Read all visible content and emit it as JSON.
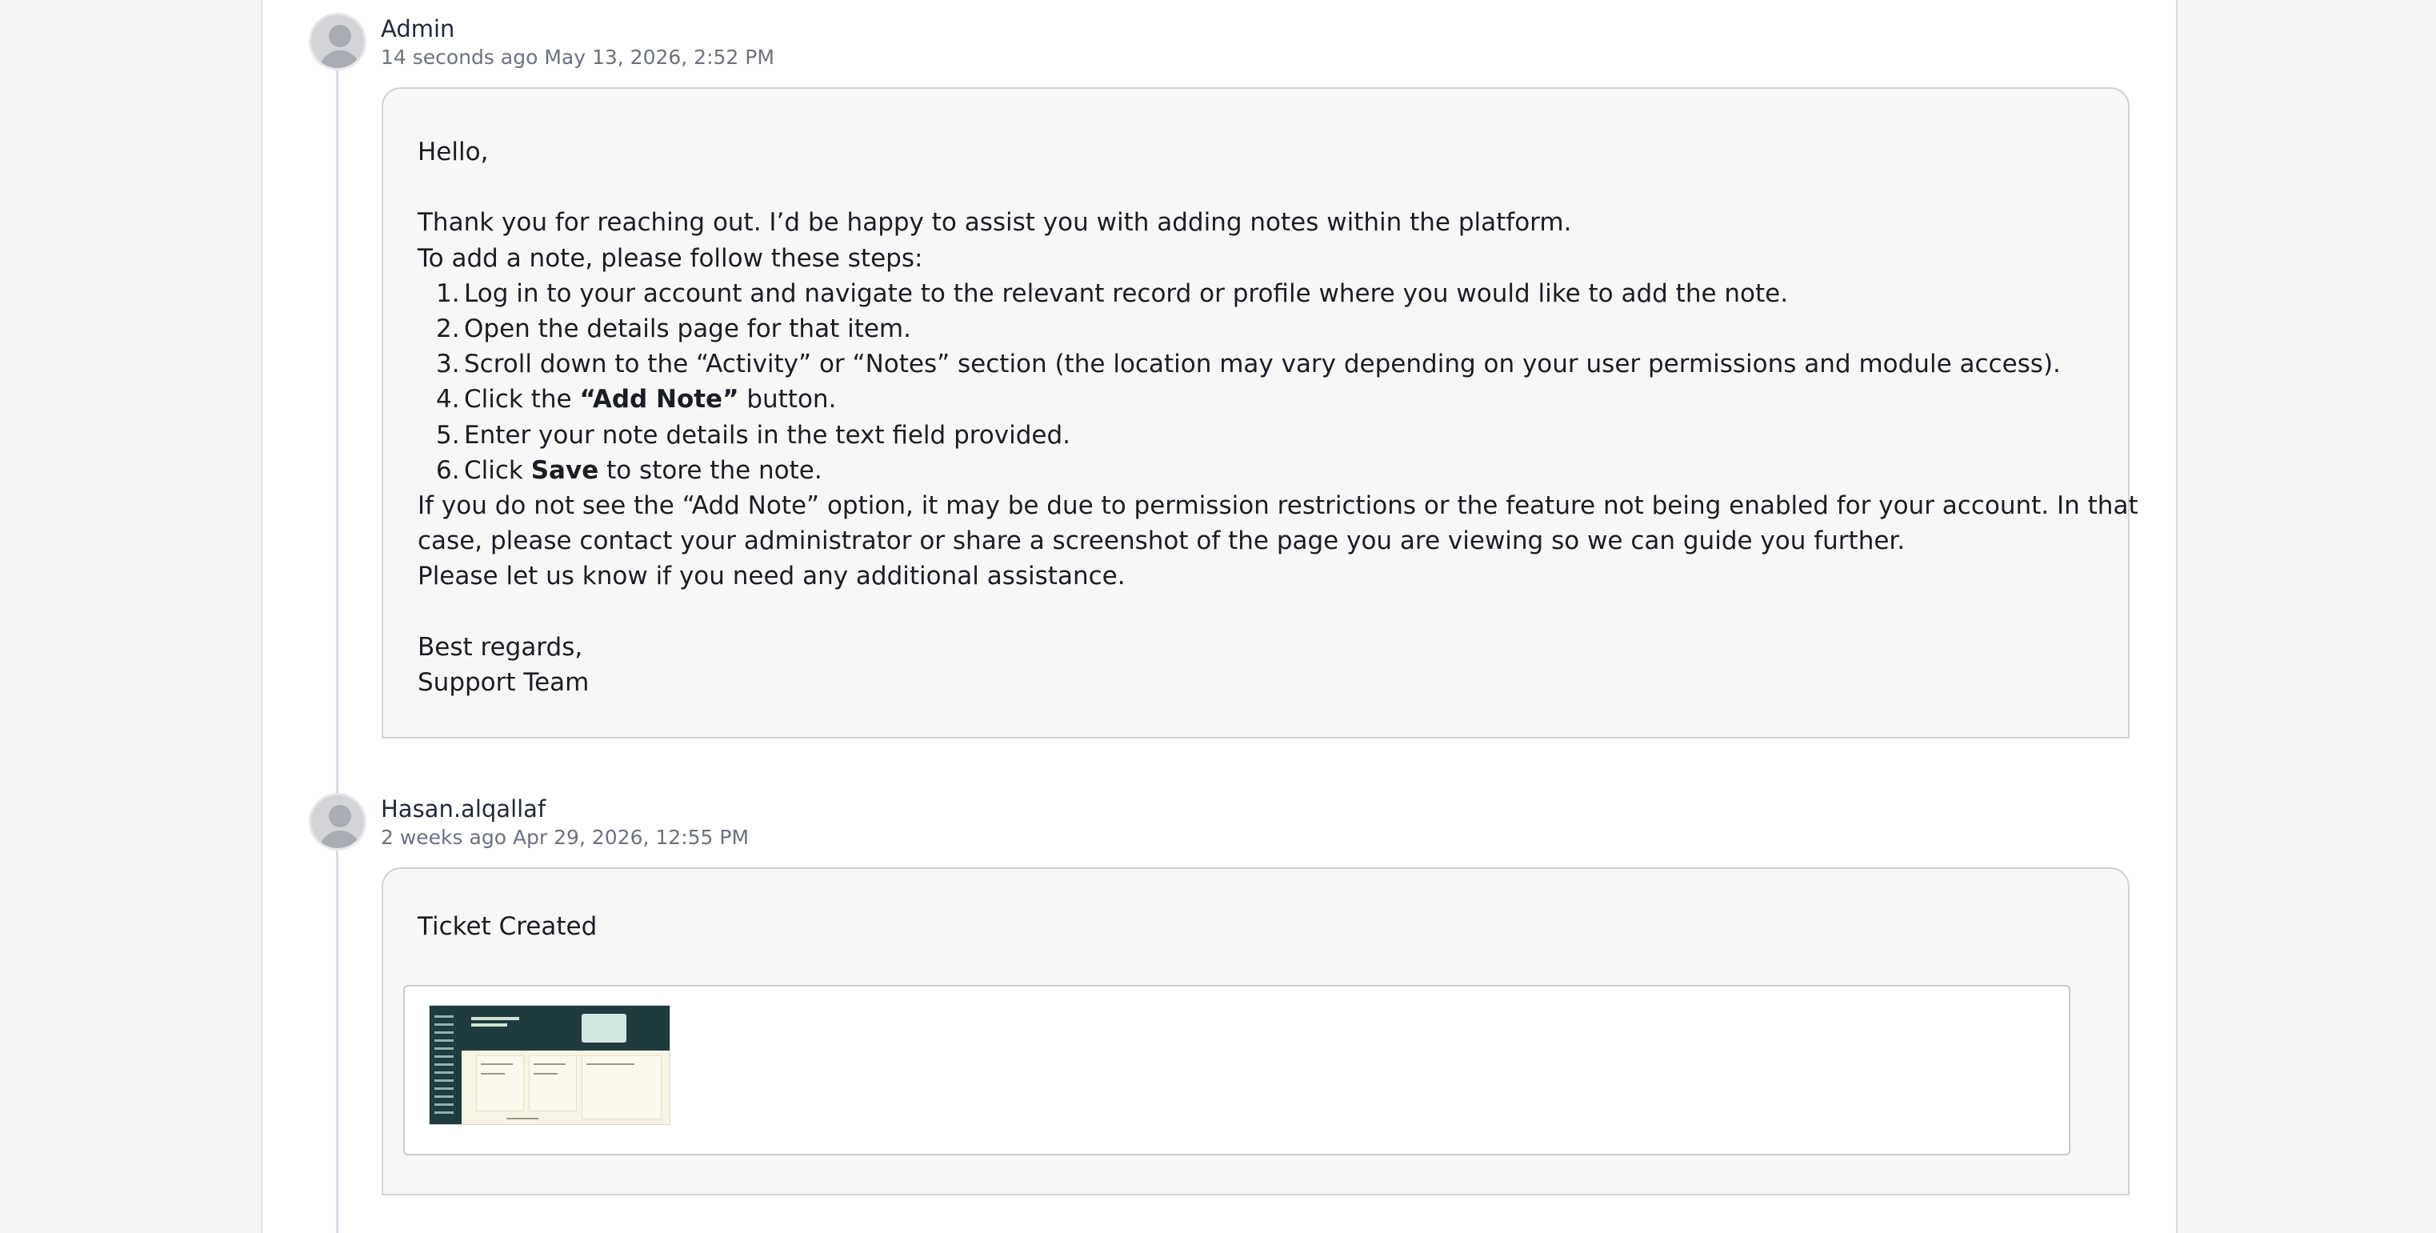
{
  "entries": [
    {
      "author": "Admin",
      "relative_time": "14 seconds ago",
      "timestamp": "May 13, 2026, 2:52 PM",
      "message": {
        "greeting": "Hello,",
        "intro_1": "Thank you for reaching out. I’d be happy to assist you with adding notes within the platform.",
        "intro_2": "To add a note, please follow these steps:",
        "steps": [
          {
            "num": "1.",
            "text": "Log in to your account and navigate to the relevant record or profile where you would like to add the note."
          },
          {
            "num": "2.",
            "text": "Open the details page for that item."
          },
          {
            "num": "3.",
            "text": "Scroll down to the “Activity” or “Notes” section (the location may vary depending on your user permissions and module access)."
          },
          {
            "num": "4.",
            "pre": "Click the ",
            "bold": "“Add Note”",
            "post": " button."
          },
          {
            "num": "5.",
            "text": "Enter your note details in the text field provided."
          },
          {
            "num": "6.",
            "pre": "Click ",
            "bold": "Save",
            "post": " to store the note."
          }
        ],
        "outro_1": "If you do not see the “Add Note” option, it may be due to permission restrictions or the feature not being enabled for your account. In that",
        "outro_2": "case, please contact your administrator or share a screenshot of the page you are viewing so we can guide you further.",
        "outro_3": "Please let us know if you need any additional assistance.",
        "signoff": "Best regards,",
        "signature": "Support Team"
      }
    },
    {
      "author": "Hasan.alqallaf",
      "relative_time": "2 weeks ago",
      "timestamp": "Apr 29, 2026, 12:55 PM",
      "title": "Ticket Created",
      "attachment_icon": "screenshot-thumbnail"
    }
  ],
  "colors": {
    "background": "#f3f4f6",
    "panel": "#ffffff",
    "bubble": "#f7f7f7",
    "meta_text": "#6b7280"
  }
}
